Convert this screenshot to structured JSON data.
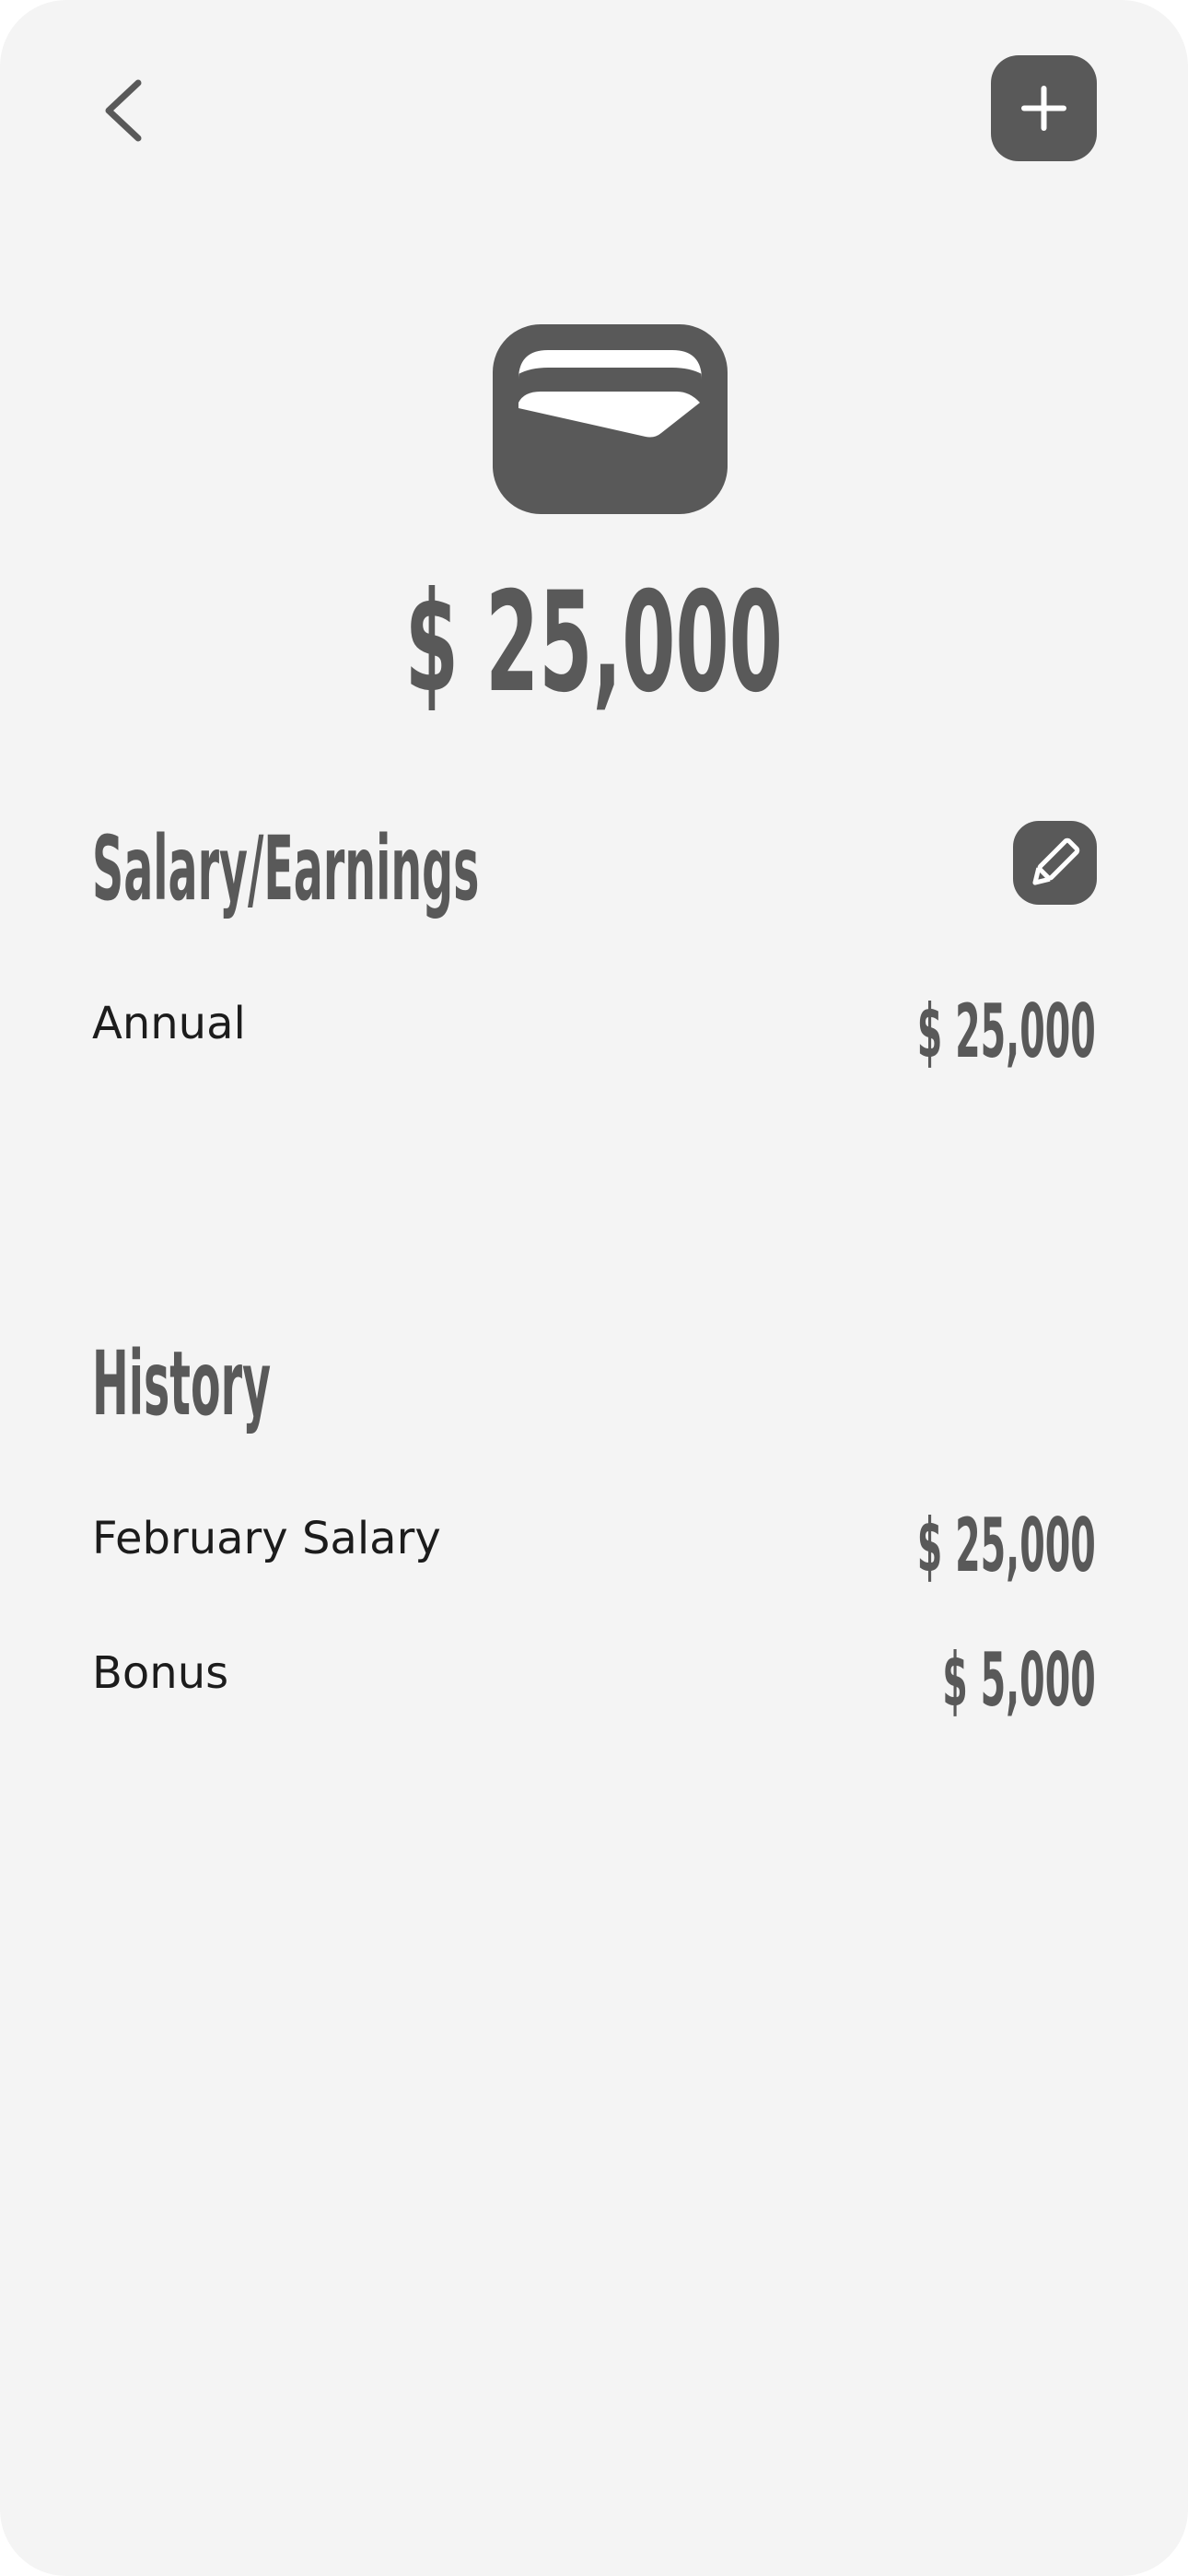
{
  "header": {
    "back_icon": "chevron-left-icon",
    "add_icon": "plus-icon"
  },
  "summary": {
    "icon": "wallet-icon",
    "amount": "$ 25,000"
  },
  "salary_section": {
    "title": "Salary/Earnings",
    "edit_icon": "pencil-icon",
    "rows": [
      {
        "label": "Annual",
        "value": "$ 25,000"
      }
    ]
  },
  "history_section": {
    "title": "History",
    "items": [
      {
        "label": "February Salary",
        "value": "$ 25,000"
      },
      {
        "label": "Bonus",
        "value": "$ 5,000"
      }
    ]
  },
  "colors": {
    "background": "#f4f4f4",
    "accent": "#595959",
    "text": "#1c1c1c",
    "icon_foreground": "#ffffff"
  }
}
